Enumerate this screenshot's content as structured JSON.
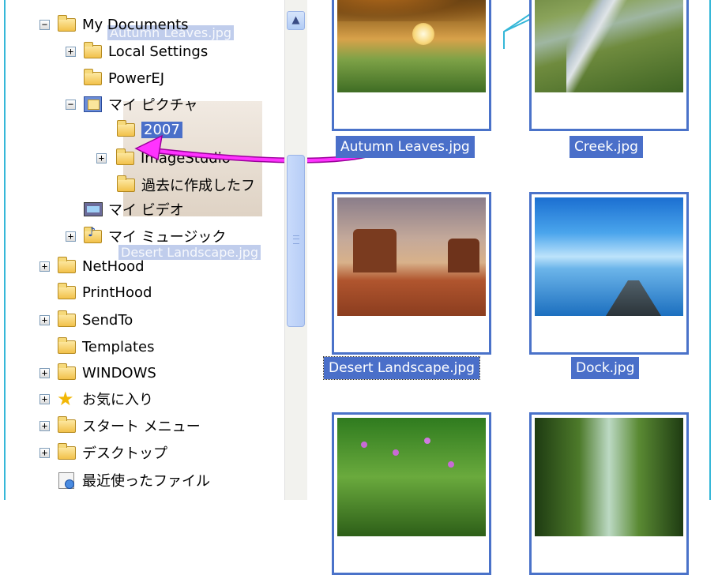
{
  "tree": {
    "items": [
      {
        "label": "My Documents",
        "expander": "−",
        "icon": "folder-icon"
      },
      {
        "label": "Local Settings",
        "expander": "+",
        "icon": "folder-icon"
      },
      {
        "label": "PowerEJ",
        "expander": "",
        "icon": "folder-icon"
      },
      {
        "label": "マイ ピクチャ",
        "expander": "−",
        "icon": "pictures-folder-icon"
      },
      {
        "label": "2007",
        "expander": "",
        "icon": "folder-icon",
        "selected": true
      },
      {
        "label": "ImageStudio",
        "expander": "+",
        "icon": "folder-icon"
      },
      {
        "label": "過去に作成したフ",
        "expander": "",
        "icon": "folder-icon"
      },
      {
        "label": "マイ ビデオ",
        "expander": "",
        "icon": "video-folder-icon"
      },
      {
        "label": "マイ ミュージック",
        "expander": "+",
        "icon": "music-folder-icon"
      },
      {
        "label": "NetHood",
        "expander": "+",
        "icon": "folder-icon"
      },
      {
        "label": "PrintHood",
        "expander": "",
        "icon": "folder-icon"
      },
      {
        "label": "SendTo",
        "expander": "+",
        "icon": "folder-icon"
      },
      {
        "label": "Templates",
        "expander": "",
        "icon": "folder-icon"
      },
      {
        "label": "WINDOWS",
        "expander": "+",
        "icon": "folder-icon"
      },
      {
        "label": "お気に入り",
        "expander": "+",
        "icon": "star-icon"
      },
      {
        "label": "スタート メニュー",
        "expander": "+",
        "icon": "folder-icon"
      },
      {
        "label": "デスクトップ",
        "expander": "+",
        "icon": "folder-icon"
      },
      {
        "label": "最近使ったファイル",
        "expander": "",
        "icon": "recent-files-icon"
      }
    ]
  },
  "drag_ghosts": {
    "autumn": "Autumn Leaves.jpg",
    "desert": "Desert Landscape.jpg"
  },
  "thumbnails": [
    {
      "name": "Autumn Leaves.jpg",
      "art": "autumn"
    },
    {
      "name": "Creek.jpg",
      "art": "creek"
    },
    {
      "name": "Desert Landscape.jpg",
      "art": "desert"
    },
    {
      "name": "Dock.jpg",
      "art": "dock"
    },
    {
      "name": "",
      "art": "flowers"
    },
    {
      "name": "",
      "art": "forest"
    }
  ],
  "colors": {
    "selection": "#4a6fc9",
    "border_accent": "#35b7d8",
    "drag_arrow": "#e000e0"
  }
}
